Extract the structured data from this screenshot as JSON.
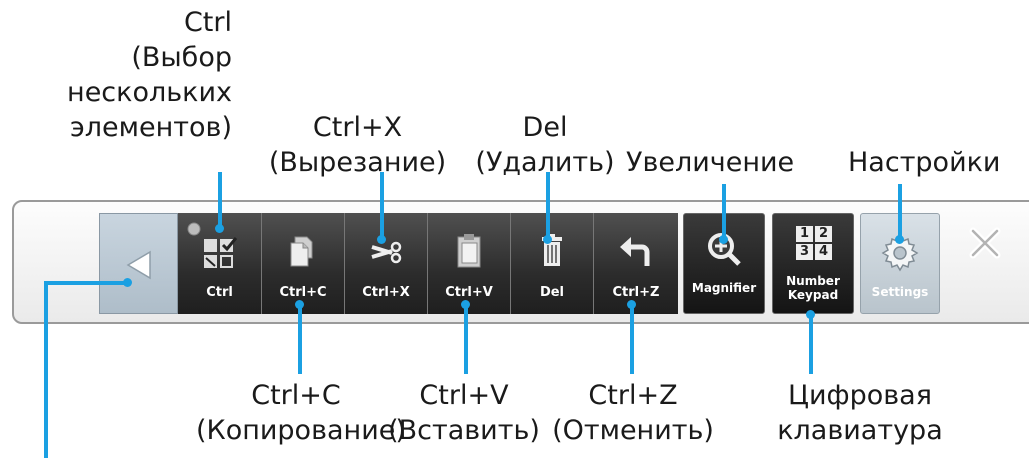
{
  "callouts": {
    "ctrl": [
      "Ctrl",
      "(Выбор",
      "нескольких",
      "элементов)"
    ],
    "ctrl_x": [
      "Ctrl+X",
      "(Вырезание)"
    ],
    "del": [
      "Del",
      "(Удалить)"
    ],
    "magnifier": [
      "Увеличение"
    ],
    "settings": [
      "Настройки"
    ],
    "ctrl_c": [
      "Ctrl+C",
      "(Копирование)"
    ],
    "ctrl_v": [
      "Ctrl+V",
      "(Вставить)"
    ],
    "ctrl_z": [
      "Ctrl+Z",
      "(Отменить)"
    ],
    "keypad": [
      "Цифровая",
      "клавиатура"
    ]
  },
  "toolbar": {
    "keys": [
      {
        "label": "Ctrl",
        "icon": "multi-select-icon"
      },
      {
        "label": "Ctrl+C",
        "icon": "copy-icon"
      },
      {
        "label": "Ctrl+X",
        "icon": "scissors-icon"
      },
      {
        "label": "Ctrl+V",
        "icon": "paste-icon"
      },
      {
        "label": "Del",
        "icon": "trash-icon"
      },
      {
        "label": "Ctrl+Z",
        "icon": "undo-icon"
      }
    ],
    "magnifier_label": "Magnifier",
    "keypad_label_1": "Number",
    "keypad_label_2": "Keypad",
    "keypad_digits": [
      "1",
      "2",
      "3",
      "4"
    ],
    "settings_label": "Settings"
  },
  "colors": {
    "leader": "#1ba0e2",
    "key_bg": "#2c2c2c",
    "back_bg": "#b8c6d1"
  }
}
